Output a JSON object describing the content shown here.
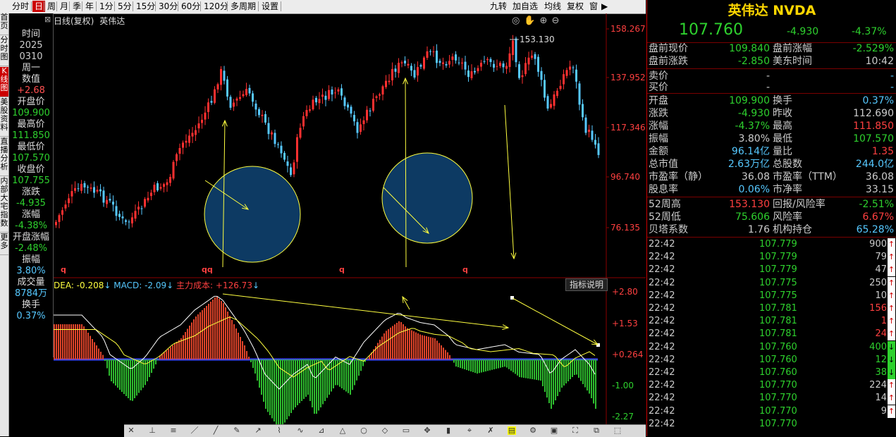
{
  "toolbar": {
    "periods": [
      "分时",
      "日",
      "周",
      "月",
      "季",
      "年",
      "1分",
      "5分",
      "15分",
      "30分",
      "60分",
      "120分",
      "多周期",
      "设置"
    ],
    "active_period": "日",
    "right_buttons": [
      "九转",
      "加自选",
      "均线",
      "复权",
      "窗"
    ]
  },
  "left_tabs": [
    "首页",
    "分时图",
    "K线图",
    "美股资料",
    "直播分析",
    "内部大宅指数",
    "更多"
  ],
  "chart_header": {
    "mode": "日线(复权)",
    "name": "英伟达",
    "high_label": "153.130"
  },
  "info_column": [
    {
      "k": "时间",
      "v": "2025"
    },
    {
      "k": "",
      "v": "0310"
    },
    {
      "k": "周一",
      "v": ""
    },
    {
      "k": "数值",
      "v": "+2.68"
    },
    {
      "k": "开盘价",
      "v": "109.900"
    },
    {
      "k": "最高价",
      "v": "111.850"
    },
    {
      "k": "最低价",
      "v": "107.570"
    },
    {
      "k": "收盘价",
      "v": "107.755"
    },
    {
      "k": "涨跌",
      "v": "-4.935"
    },
    {
      "k": "涨幅",
      "v": "-4.38%"
    },
    {
      "k": "开盘涨幅",
      "v": "-2.48%"
    },
    {
      "k": "振幅",
      "v": "3.80%"
    },
    {
      "k": "成交量",
      "v": "8784万"
    },
    {
      "k": "换手",
      "v": "0.37%"
    }
  ],
  "price_axis": [
    "158.267",
    "137.952",
    "117.346",
    "96.740",
    "76.135"
  ],
  "macd_axis": [
    "+2.80",
    "+1.53",
    "+0.264",
    "-1.00",
    "-2.27"
  ],
  "macd_header": {
    "dea": "DEA: -0.208",
    "macd": "MACD: -2.09",
    "cost": "主力成本: +126.73",
    "explain": "指标说明"
  },
  "quote": {
    "title": "英伟达 NVDA",
    "price": "107.760",
    "change": "-4.930",
    "change_pct": "-4.37%",
    "rows": [
      [
        "盘前现价",
        "109.840",
        "盘前涨幅",
        "-2.529%"
      ],
      [
        "盘前涨跌",
        "-2.850",
        "美东时间",
        "10:42"
      ]
    ],
    "bidask": [
      [
        "卖价",
        "-"
      ],
      [
        "买价",
        "-"
      ]
    ],
    "stats": [
      [
        "开盘",
        "109.900",
        "换手",
        "0.37%"
      ],
      [
        "涨跌",
        "-4.930",
        "昨收",
        "112.690"
      ],
      [
        "涨幅",
        "-4.37%",
        "最高",
        "111.850"
      ],
      [
        "振幅",
        "3.80%",
        "最低",
        "107.570"
      ],
      [
        "金额",
        "96.14亿",
        "量比",
        "1.35"
      ],
      [
        "总市值",
        "2.63万亿",
        "总股数",
        "244.0亿"
      ],
      [
        "市盈率（静）",
        "36.08",
        "市盈率（TTM）",
        "36.08"
      ],
      [
        "股息率",
        "0.06%",
        "市净率",
        "33.15"
      ]
    ],
    "stats52": [
      [
        "52周高",
        "153.130",
        "回报/风险率",
        "-2.51%"
      ],
      [
        "52周低",
        "75.606",
        "风险率",
        "6.67%"
      ],
      [
        "贝塔系数",
        "1.76",
        "机构持仓",
        "65.28%"
      ]
    ],
    "ticks": [
      [
        "22:42",
        "107.779",
        "900",
        "up"
      ],
      [
        "22:42",
        "107.779",
        "79",
        "up"
      ],
      [
        "22:42",
        "107.779",
        "47",
        "up"
      ],
      [
        "22:42",
        "107.775",
        "250",
        "up"
      ],
      [
        "22:42",
        "107.775",
        "10",
        "up"
      ],
      [
        "22:42",
        "107.781",
        "156",
        "up"
      ],
      [
        "22:42",
        "107.781",
        "1",
        "up"
      ],
      [
        "22:42",
        "107.781",
        "24",
        "up"
      ],
      [
        "22:42",
        "107.760",
        "400",
        "dn"
      ],
      [
        "22:42",
        "107.760",
        "12",
        "dn"
      ],
      [
        "22:42",
        "107.760",
        "38",
        "dn"
      ],
      [
        "22:42",
        "107.770",
        "224",
        "up"
      ],
      [
        "22:42",
        "107.770",
        "14",
        "up"
      ],
      [
        "22:42",
        "107.770",
        "9",
        "up"
      ],
      [
        "22:42",
        "107.770",
        "",
        ""
      ]
    ]
  },
  "colors": {
    "up": "#ff4040",
    "down": "#2ed12e",
    "cyan": "#56c8ff",
    "yellow": "#ffff40",
    "accent": "#cc0000"
  }
}
